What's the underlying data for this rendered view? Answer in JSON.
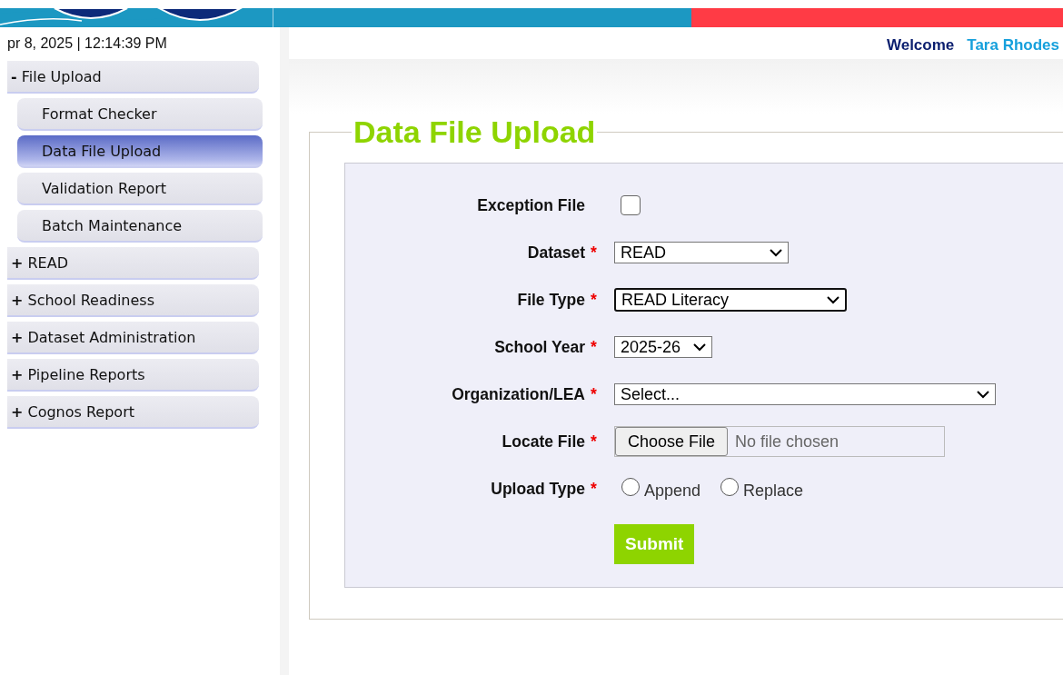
{
  "datetime": "pr 8, 2025 | 12:14:39 PM",
  "welcome": {
    "label": "Welcome",
    "user": "Tara Rhodes"
  },
  "sidebar": {
    "items": [
      {
        "label": "File Upload",
        "expander": "-",
        "children": [
          {
            "label": "Format Checker",
            "selected": false
          },
          {
            "label": "Data File Upload",
            "selected": true
          },
          {
            "label": "Validation Report",
            "selected": false
          },
          {
            "label": "Batch Maintenance",
            "selected": false
          }
        ]
      },
      {
        "label": "READ",
        "expander": "+"
      },
      {
        "label": "School Readiness",
        "expander": "+"
      },
      {
        "label": "Dataset Administration",
        "expander": "+"
      },
      {
        "label": "Pipeline Reports",
        "expander": "+"
      },
      {
        "label": "Cognos Report",
        "expander": "+"
      }
    ]
  },
  "form": {
    "title": "Data File Upload",
    "fields": [
      {
        "kind": "checkbox",
        "label": "Exception File",
        "checked": false
      },
      {
        "kind": "select",
        "label": "Dataset",
        "required_mark": "*",
        "value": "READ",
        "focused": false
      },
      {
        "kind": "select",
        "label": "File Type",
        "required_mark": "*",
        "value": "READ Literacy",
        "focused": true
      },
      {
        "kind": "select",
        "label": "School Year",
        "required_mark": "*",
        "value": "2025-26",
        "focused": false
      },
      {
        "kind": "select",
        "label": "Organization/LEA",
        "required_mark": "*",
        "value": "Select...",
        "focused": false
      },
      {
        "kind": "file",
        "label": "Locate File",
        "required_mark": "*",
        "button": "Choose File",
        "status": "No file chosen"
      },
      {
        "kind": "radio",
        "label": "Upload Type",
        "required_mark": "*",
        "options": [
          {
            "label": "Append",
            "selected": false
          },
          {
            "label": "Replace",
            "selected": false
          }
        ]
      }
    ],
    "submit": "Submit"
  }
}
